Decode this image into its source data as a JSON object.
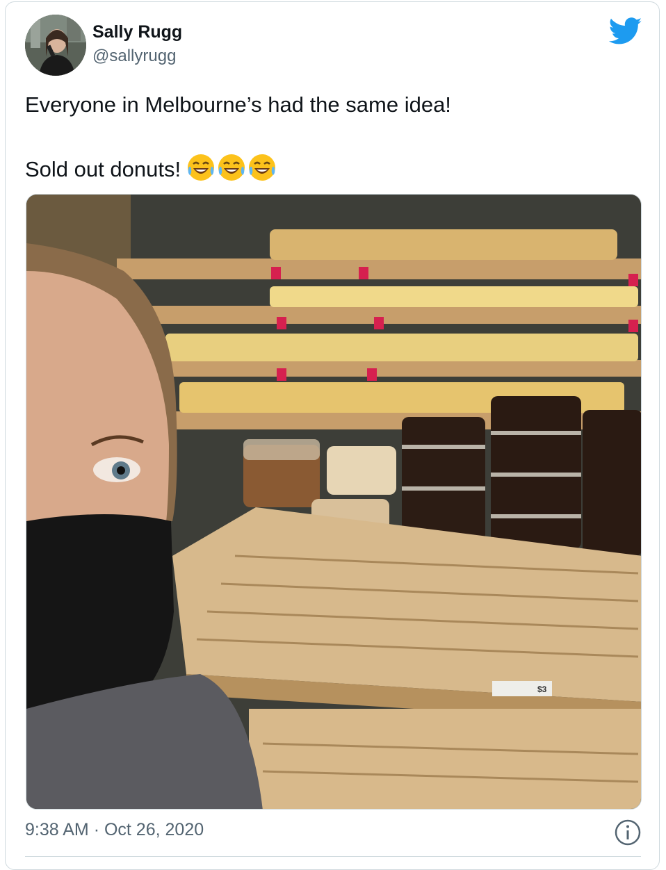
{
  "tweet": {
    "author_name": "Sally Rugg",
    "author_handle": "@sallyrugg",
    "text_line1": "Everyone in Melbourne’s had the same idea!",
    "text_line2": "Sold out donuts!",
    "emoji": [
      "face-with-tears-of-joy",
      "face-with-tears-of-joy",
      "face-with-tears-of-joy"
    ],
    "time": "9:38 AM",
    "separator": "·",
    "date": "Oct 26, 2020",
    "price_tag": "$3"
  },
  "colors": {
    "twitter_blue": "#1d9bf0",
    "text_primary": "#0f1419",
    "text_secondary": "#536471",
    "border": "#cfd9de"
  },
  "icons": {
    "brand": "twitter-bird-icon",
    "info": "info-icon"
  }
}
